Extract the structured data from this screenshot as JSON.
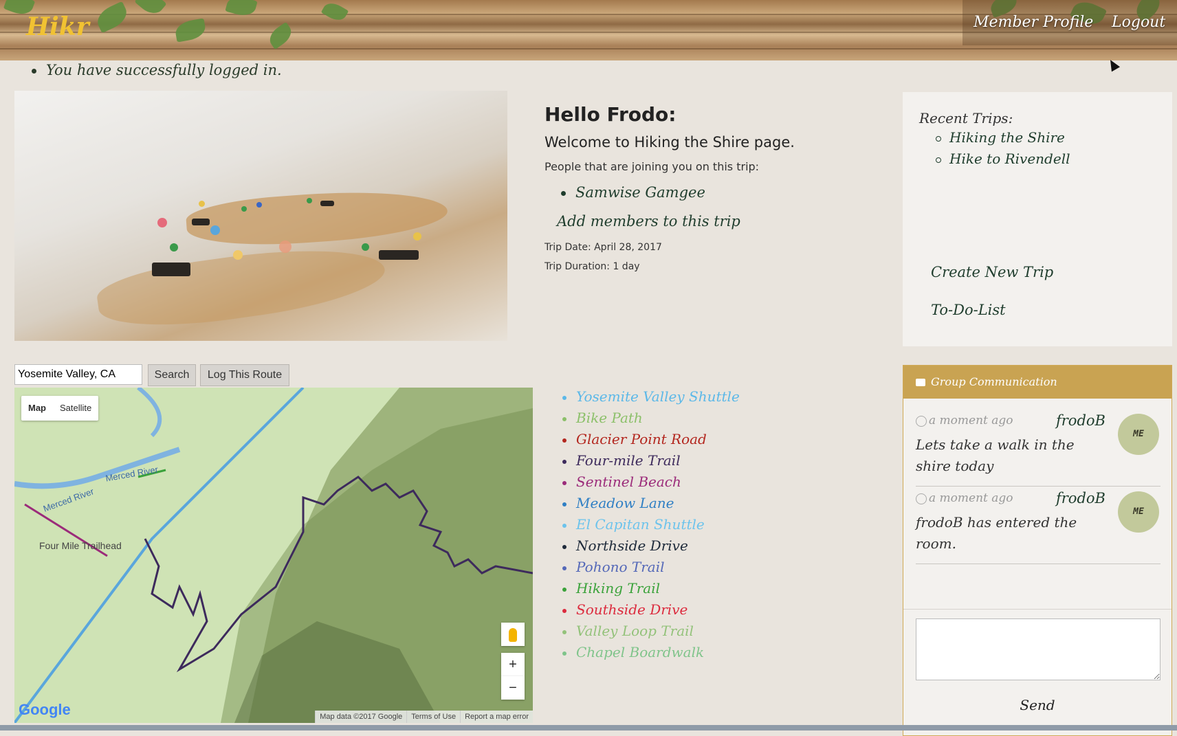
{
  "header": {
    "logo": "Hikr",
    "nav": {
      "profile": "Member Profile",
      "logout": "Logout"
    }
  },
  "flash": {
    "message": "You have successfully logged in."
  },
  "trip": {
    "greeting": "Hello Frodo:",
    "welcome": "Welcome to Hiking the Shire page.",
    "joining_label": "People that are joining you on this trip:",
    "members": [
      "Samwise Gamgee"
    ],
    "add_members": "Add members to this trip",
    "date": "Trip Date: April 28, 2017",
    "duration": "Trip Duration: 1 day"
  },
  "sidebar": {
    "recent_title": "Recent Trips:",
    "recent_trips": [
      "Hiking the Shire",
      "Hike to Rivendell"
    ],
    "create_trip": "Create New Trip",
    "todo": "To-Do-List"
  },
  "search": {
    "value": "Yosemite Valley, CA",
    "search_button": "Search",
    "log_button": "Log This Route"
  },
  "map": {
    "type_map": "Map",
    "type_satellite": "Satellite",
    "zoom_in": "+",
    "zoom_out": "−",
    "logo": "Google",
    "labels": [
      "Merced River",
      "Merced River",
      "Four Mile Trailhead"
    ],
    "footer": [
      "Map data ©2017 Google",
      "Terms of Use",
      "Report a map error"
    ]
  },
  "trails": [
    {
      "name": "Yosemite Valley Shuttle",
      "color": "#5bb8e8"
    },
    {
      "name": "Bike Path",
      "color": "#8cc06a"
    },
    {
      "name": "Glacier Point Road",
      "color": "#b3261e"
    },
    {
      "name": "Four-mile Trail",
      "color": "#3d2a5c"
    },
    {
      "name": "Sentinel Beach",
      "color": "#9b2b7a"
    },
    {
      "name": "Meadow Lane",
      "color": "#2f7fc4"
    },
    {
      "name": "El Capitan Shuttle",
      "color": "#6cc3ec"
    },
    {
      "name": "Northside Drive",
      "color": "#1e2a3a"
    },
    {
      "name": "Pohono Trail",
      "color": "#5468b8"
    },
    {
      "name": "Hiking Trail",
      "color": "#3aa23a"
    },
    {
      "name": "Southside Drive",
      "color": "#dc2b3e"
    },
    {
      "name": "Valley Loop Trail",
      "color": "#93c27a"
    },
    {
      "name": "Chapel Boardwalk",
      "color": "#7fc48a"
    }
  ],
  "chat": {
    "title": "Group Communication",
    "messages": [
      {
        "time": "a moment ago",
        "user": "frodoB",
        "text": "Lets take a walk in the shire today",
        "avatar": "ME"
      },
      {
        "time": "a moment ago",
        "user": "frodoB",
        "text": "frodoB has entered the room.",
        "avatar": "ME"
      }
    ],
    "send": "Send"
  }
}
